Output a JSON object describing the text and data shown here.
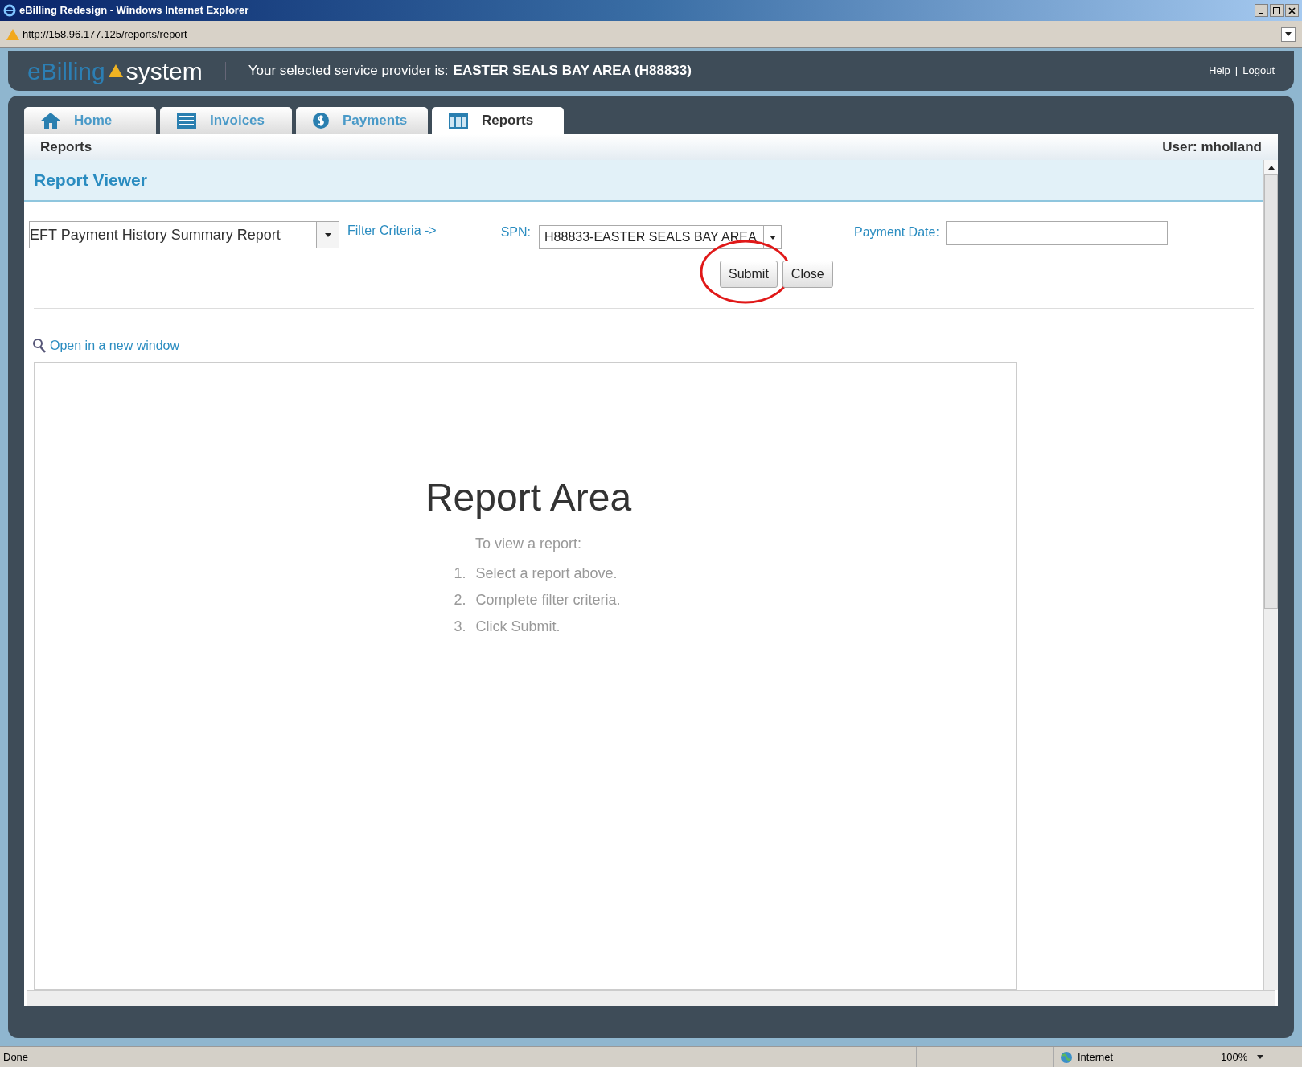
{
  "window": {
    "title": "eBilling Redesign - Windows Internet Explorer",
    "address": "http://158.96.177.125/reports/report"
  },
  "header": {
    "logo_left": "eBilling",
    "logo_right": "system",
    "provider_label": "Your selected service provider is:",
    "provider": "EASTER SEALS BAY AREA (H88833)",
    "links": [
      "Help",
      "Logout"
    ],
    "separator": "|"
  },
  "tabs": [
    {
      "label": "Home",
      "kind": "home",
      "selected": false
    },
    {
      "label": "Invoices",
      "kind": "list",
      "selected": false
    },
    {
      "label": "Payments",
      "kind": "dollar",
      "selected": false
    },
    {
      "label": "Reports",
      "kind": "table",
      "selected": true
    }
  ],
  "subheader": {
    "title": "Reports",
    "user": "User: mholland"
  },
  "panel": {
    "title": "Report Viewer"
  },
  "form": {
    "report": "EFT Payment History Summary Report",
    "filter_link": "Filter Criteria ->",
    "spn_label": "SPN:",
    "spn": "H88833-EASTER SEALS BAY AREA",
    "date_label": "Payment Date:",
    "buttons": [
      {
        "label": "Submit",
        "highlighted": true
      },
      {
        "label": "Close"
      }
    ]
  },
  "open_link": "Open in a new window",
  "report_area": {
    "title": "Report Area",
    "subtitle": "To view a report:",
    "steps": [
      {
        "number": "1.",
        "text": "Select a report above."
      },
      {
        "number": "2.",
        "text": "Complete filter criteria."
      },
      {
        "number": "3.",
        "text": "Click Submit."
      }
    ]
  },
  "status_bar": {
    "status": "Done",
    "zone": "Internet",
    "zoom": "100%"
  }
}
